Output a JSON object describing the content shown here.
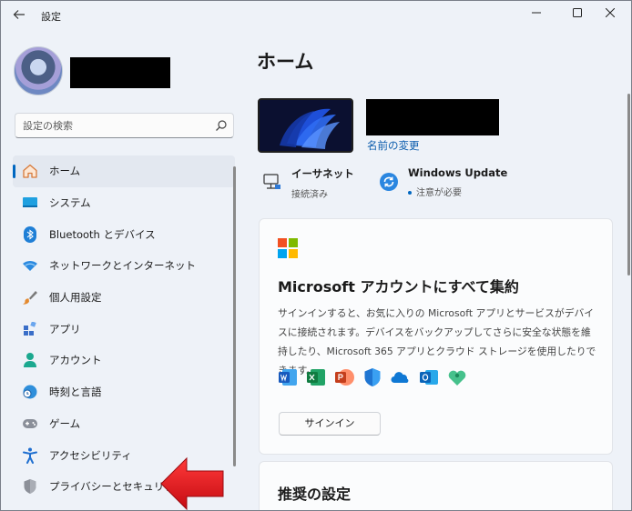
{
  "window": {
    "title": "設定"
  },
  "sidebar": {
    "search_placeholder": "設定の検索",
    "items": [
      {
        "label": "ホーム",
        "icon": "home-icon",
        "active": true
      },
      {
        "label": "システム",
        "icon": "system-icon"
      },
      {
        "label": "Bluetooth とデバイス",
        "icon": "bluetooth-icon"
      },
      {
        "label": "ネットワークとインターネット",
        "icon": "network-icon"
      },
      {
        "label": "個人用設定",
        "icon": "brush-icon"
      },
      {
        "label": "アプリ",
        "icon": "apps-icon"
      },
      {
        "label": "アカウント",
        "icon": "account-icon"
      },
      {
        "label": "時刻と言語",
        "icon": "time-language-icon"
      },
      {
        "label": "ゲーム",
        "icon": "gamepad-icon"
      },
      {
        "label": "アクセシビリティ",
        "icon": "accessibility-icon"
      },
      {
        "label": "プライバシーとセキュリティ",
        "icon": "shield-icon"
      }
    ]
  },
  "main": {
    "title": "ホーム",
    "rename_link": "名前の変更",
    "status": [
      {
        "title": "イーサネット",
        "sub": "接続済み",
        "icon": "ethernet-icon"
      },
      {
        "title": "Windows Update",
        "sub": "注意が必要",
        "icon": "windows-update-icon"
      }
    ],
    "ms_card": {
      "title": "Microsoft アカウントにすべて集約",
      "desc": "サインインすると、お気に入りの Microsoft アプリとサービスがデバイスに接続されます。デバイスをバックアップしてさらに安全な状態を維持したり、Microsoft 365 アプリとクラウド ストレージを使用したりできます。",
      "signin": "サインイン",
      "apps": [
        "word-icon",
        "excel-icon",
        "powerpoint-icon",
        "defender-icon",
        "onedrive-icon",
        "outlook-icon",
        "family-icon"
      ]
    },
    "recommended_title": "推奨の設定"
  },
  "colors": {
    "accent": "#0067c0",
    "arrow": "#e8121b"
  }
}
